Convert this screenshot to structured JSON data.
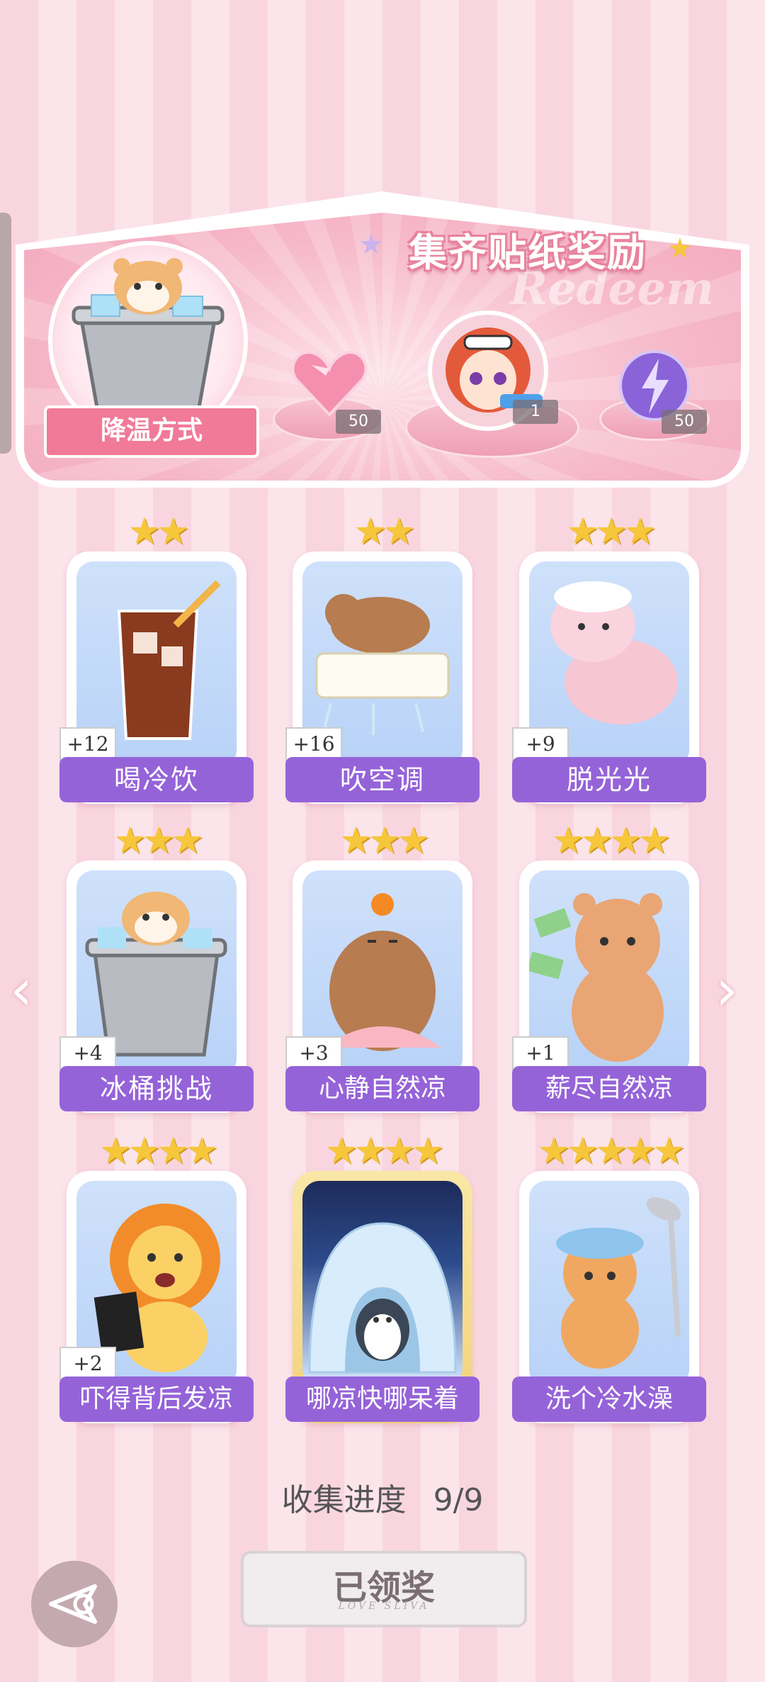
{
  "reward_panel": {
    "title": "集齐贴纸奖励",
    "category_label": "降温方式",
    "rewards": [
      {
        "name": "heart-gem",
        "count": "50"
      },
      {
        "name": "character-avatar",
        "count": "1"
      },
      {
        "name": "lightning-orb",
        "count": "50"
      }
    ]
  },
  "stickers": [
    {
      "label": "喝冷饮",
      "bonus": "+12",
      "stars": "★★"
    },
    {
      "label": "吹空调",
      "bonus": "+16",
      "stars": "★★"
    },
    {
      "label": "脱光光",
      "bonus": "+9",
      "stars": "★★★"
    },
    {
      "label": "冰桶挑战",
      "bonus": "+4",
      "stars": "★★★"
    },
    {
      "label": "心静自然凉",
      "bonus": "+3",
      "stars": "★★★"
    },
    {
      "label": "薪尽自然凉",
      "bonus": "+1",
      "stars": "★★★★"
    },
    {
      "label": "吓得背后发凉",
      "bonus": "+2",
      "stars": "★★★★"
    },
    {
      "label": "哪凉快哪呆着",
      "bonus": "",
      "stars": "★★★★"
    },
    {
      "label": "洗个冷水澡",
      "bonus": "",
      "stars": "★★★★★"
    }
  ],
  "progress": {
    "label": "收集进度",
    "value": "9/9"
  },
  "claim_button": {
    "label": "已领奖",
    "sub": "LOVE SLIVA"
  },
  "colors": {
    "label_purple": "#9563d8",
    "ribbon_pink": "#f07a98",
    "star_gold": "#f6c63b"
  }
}
